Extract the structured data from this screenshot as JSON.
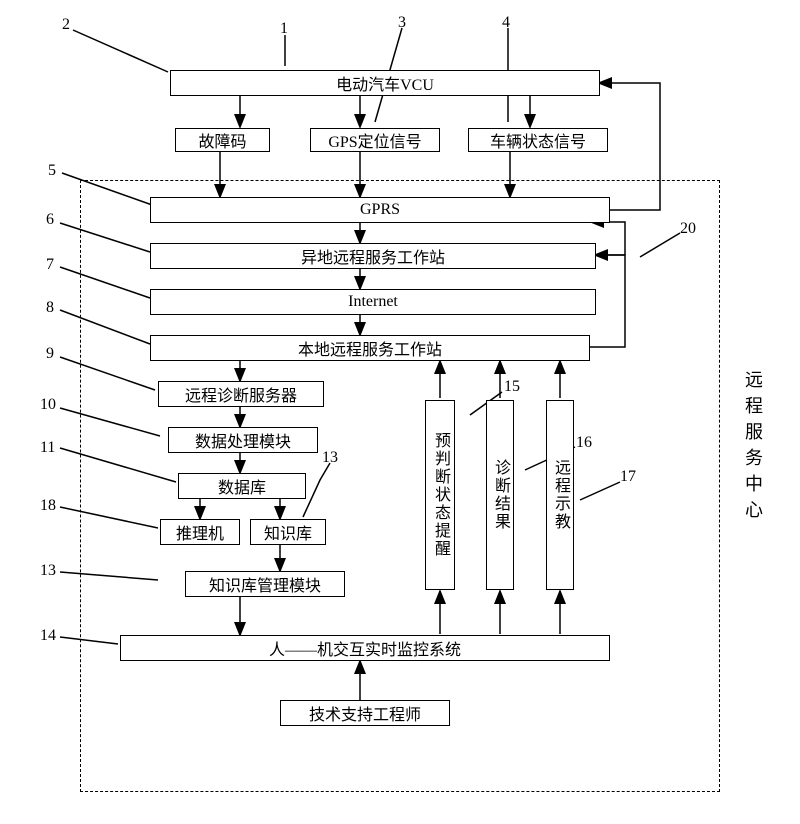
{
  "nodes": {
    "vcu": "电动汽车VCU",
    "fault_code": "故障码",
    "gps_signal": "GPS定位信号",
    "vehicle_status": "车辆状态信号",
    "gprs": "GPRS",
    "remote_ws": "异地远程服务工作站",
    "internet": "Internet",
    "local_ws": "本地远程服务工作站",
    "diag_server": "远程诊断服务器",
    "data_proc": "数据处理模块",
    "database": "数据库",
    "inference": "推理机",
    "kb": "知识库",
    "kb_mgmt": "知识库管理模块",
    "hmi": "人——机交互实时监控系统",
    "engineer": "技术支持工程师",
    "prejudge": "预判断状态提醒",
    "diag_result": "诊断结果",
    "remote_teach": "远程示教"
  },
  "labels": {
    "n1": "1",
    "n2": "2",
    "n3": "3",
    "n4": "4",
    "n5": "5",
    "n6": "6",
    "n7": "7",
    "n8": "8",
    "n9": "9",
    "n10": "10",
    "n11": "11",
    "n13a": "13",
    "n13b": "13",
    "n14": "14",
    "n15": "15",
    "n16": "16",
    "n17": "17",
    "n18": "18",
    "n20": "20"
  },
  "side_label": "远程服务中心"
}
